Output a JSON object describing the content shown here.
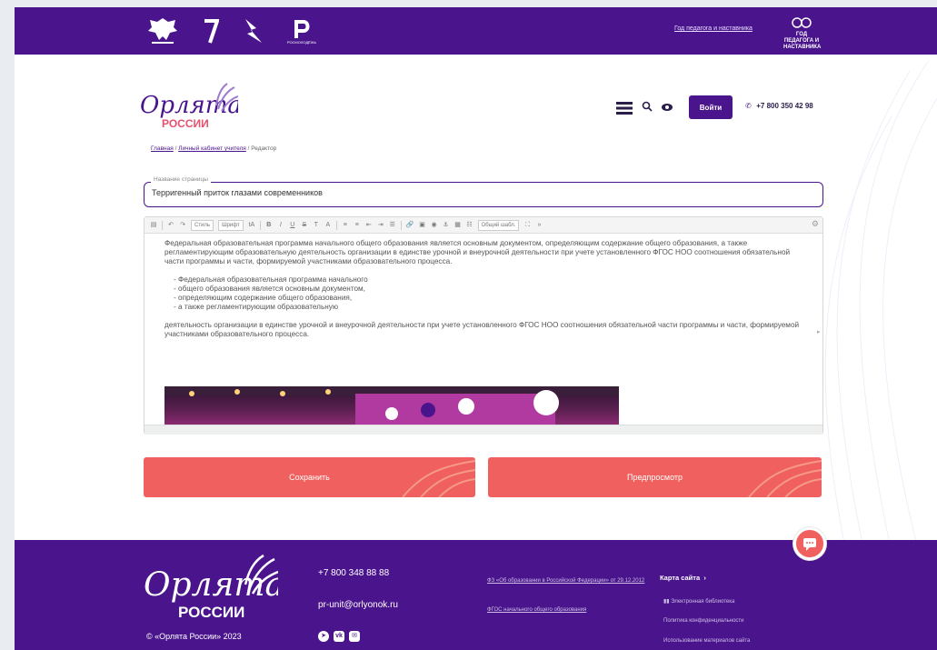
{
  "topbar": {
    "logo_labels": [
      "",
      "",
      "",
      "РОСМОЛОДЁЖЬ"
    ],
    "link_text": "Год педагога и наставника",
    "brand_text": "ГОД ПЕДАГОГА И НАСТАВНИКА"
  },
  "header": {
    "logo_line1": "Орлята",
    "logo_line2": "РОССИИ",
    "login_label": "Войти",
    "phone": "+7 800 350 42 98"
  },
  "breadcrumb": {
    "items": [
      "Главная",
      "Личный кабинет учителя",
      "Редактор"
    ]
  },
  "form": {
    "title_label": "Название страницы",
    "title_value": "Терригенный приток глазами современников"
  },
  "toolbar": {
    "style_label": "Стиль",
    "font_label": "Шрифт",
    "size_label": "Общий шабл."
  },
  "content": {
    "paragraph1": "Федеральная образовательная программа начального общего образования является основным документом, определяющим содержание общего образования, а также регламентирующим образовательную деятельность организации в единстве урочной и внеурочной деятельности при учете установленного ФГОС НОО соотношения обязательной части программы и части, формируемой участниками образовательного процесса.",
    "list": [
      "Федеральная образовательная программа начального",
      "общего образования является основным документом,",
      "определяющим содержание общего образования,",
      "а также регламентирующим образовательную"
    ],
    "paragraph2": "деятельность организации в единстве урочной и внеурочной деятельности при учете установленного ФГОС НОО соотношения обязательной части программы и части, формируемой участниками образовательного процесса."
  },
  "actions": {
    "save_label": "Сохранить",
    "preview_label": "Предпросмотр"
  },
  "footer": {
    "logo_line1": "Орлята",
    "logo_line2": "РОССИИ",
    "copyright": "© «Орлята России» 2023",
    "phone": "+7 800 348 88 88",
    "email": "pr-unit@orlyonok.ru",
    "links_mid": [
      "ФЗ «Об образовании в Российской Федерации» от 29.12.2012",
      "ФГОС начального общего образования"
    ],
    "sitemap_label": "Карта сайта",
    "links_right": [
      "Электронная библиотека",
      "Политика конфиденциальности",
      "Использование материалов сайта"
    ]
  },
  "colors": {
    "brand_purple": "#4a148c",
    "accent_coral": "#f0605e"
  }
}
